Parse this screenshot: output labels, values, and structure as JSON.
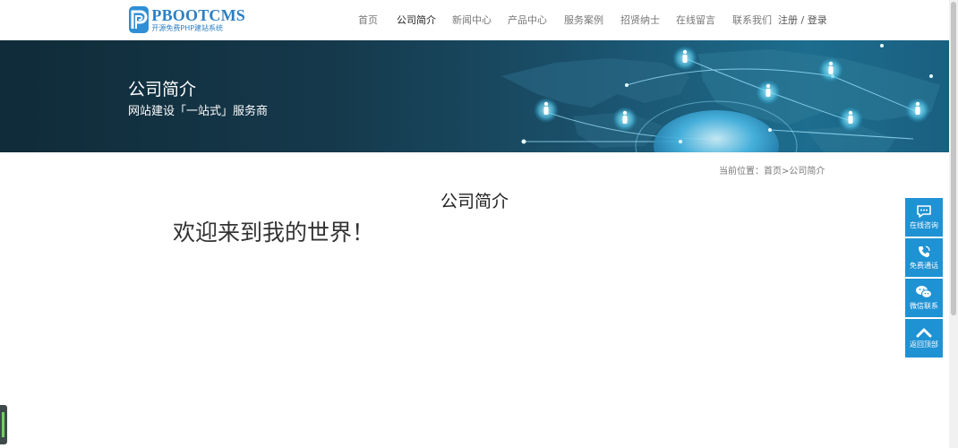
{
  "logo": {
    "name": "PBOOTCMS",
    "tagline": "开源免费PHP建站系统"
  },
  "nav": {
    "items": [
      {
        "label": "首页"
      },
      {
        "label": "公司简介"
      },
      {
        "label": "新闻中心"
      },
      {
        "label": "产品中心"
      },
      {
        "label": "服务案例"
      },
      {
        "label": "招贤纳士"
      },
      {
        "label": "在线留言"
      },
      {
        "label": "联系我们"
      }
    ],
    "active_index": 1,
    "login_text": "注册 / 登录"
  },
  "banner": {
    "title": "公司简介",
    "subtitle": "网站建设「一站式」服务商"
  },
  "breadcrumb": {
    "prefix": "当前位置：",
    "home": "首页",
    "separator": ">",
    "current": "公司简介"
  },
  "content": {
    "heading": "公司简介",
    "body": "欢迎来到我的世界！"
  },
  "side_tools": [
    {
      "label": "在线咨询",
      "icon": "chat-icon"
    },
    {
      "label": "免费通话",
      "icon": "phone-icon"
    },
    {
      "label": "微信联系",
      "icon": "wechat-icon"
    },
    {
      "label": "返回顶部",
      "icon": "arrow-up-icon"
    }
  ],
  "colors": {
    "brand": "#2a7fc4",
    "side_tool_bg": "#1f92d4",
    "banner_dark": "#102b39"
  }
}
